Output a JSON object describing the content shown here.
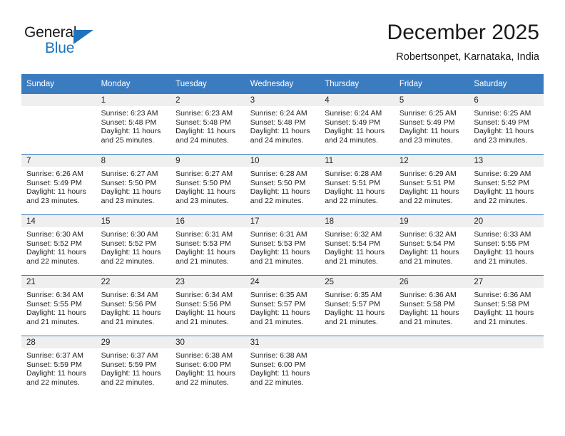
{
  "brand": {
    "name_top": "General",
    "name_bottom": "Blue",
    "triangle_color": "#1e73bd"
  },
  "header": {
    "title": "December 2025",
    "subtitle": "Robertsonpet, Karnataka, India"
  },
  "theme": {
    "header_blue": "#3b7cc0",
    "daynum_band": "#efefef",
    "text": "#222222"
  },
  "calendar": {
    "weekday_headers": [
      "Sunday",
      "Monday",
      "Tuesday",
      "Wednesday",
      "Thursday",
      "Friday",
      "Saturday"
    ],
    "weeks": [
      [
        {
          "day": "",
          "empty": true
        },
        {
          "day": "1",
          "sunrise": "Sunrise: 6:23 AM",
          "sunset": "Sunset: 5:48 PM",
          "daylight1": "Daylight: 11 hours",
          "daylight2": "and 25 minutes."
        },
        {
          "day": "2",
          "sunrise": "Sunrise: 6:23 AM",
          "sunset": "Sunset: 5:48 PM",
          "daylight1": "Daylight: 11 hours",
          "daylight2": "and 24 minutes."
        },
        {
          "day": "3",
          "sunrise": "Sunrise: 6:24 AM",
          "sunset": "Sunset: 5:48 PM",
          "daylight1": "Daylight: 11 hours",
          "daylight2": "and 24 minutes."
        },
        {
          "day": "4",
          "sunrise": "Sunrise: 6:24 AM",
          "sunset": "Sunset: 5:49 PM",
          "daylight1": "Daylight: 11 hours",
          "daylight2": "and 24 minutes."
        },
        {
          "day": "5",
          "sunrise": "Sunrise: 6:25 AM",
          "sunset": "Sunset: 5:49 PM",
          "daylight1": "Daylight: 11 hours",
          "daylight2": "and 23 minutes."
        },
        {
          "day": "6",
          "sunrise": "Sunrise: 6:25 AM",
          "sunset": "Sunset: 5:49 PM",
          "daylight1": "Daylight: 11 hours",
          "daylight2": "and 23 minutes."
        }
      ],
      [
        {
          "day": "7",
          "sunrise": "Sunrise: 6:26 AM",
          "sunset": "Sunset: 5:49 PM",
          "daylight1": "Daylight: 11 hours",
          "daylight2": "and 23 minutes."
        },
        {
          "day": "8",
          "sunrise": "Sunrise: 6:27 AM",
          "sunset": "Sunset: 5:50 PM",
          "daylight1": "Daylight: 11 hours",
          "daylight2": "and 23 minutes."
        },
        {
          "day": "9",
          "sunrise": "Sunrise: 6:27 AM",
          "sunset": "Sunset: 5:50 PM",
          "daylight1": "Daylight: 11 hours",
          "daylight2": "and 23 minutes."
        },
        {
          "day": "10",
          "sunrise": "Sunrise: 6:28 AM",
          "sunset": "Sunset: 5:50 PM",
          "daylight1": "Daylight: 11 hours",
          "daylight2": "and 22 minutes."
        },
        {
          "day": "11",
          "sunrise": "Sunrise: 6:28 AM",
          "sunset": "Sunset: 5:51 PM",
          "daylight1": "Daylight: 11 hours",
          "daylight2": "and 22 minutes."
        },
        {
          "day": "12",
          "sunrise": "Sunrise: 6:29 AM",
          "sunset": "Sunset: 5:51 PM",
          "daylight1": "Daylight: 11 hours",
          "daylight2": "and 22 minutes."
        },
        {
          "day": "13",
          "sunrise": "Sunrise: 6:29 AM",
          "sunset": "Sunset: 5:52 PM",
          "daylight1": "Daylight: 11 hours",
          "daylight2": "and 22 minutes."
        }
      ],
      [
        {
          "day": "14",
          "sunrise": "Sunrise: 6:30 AM",
          "sunset": "Sunset: 5:52 PM",
          "daylight1": "Daylight: 11 hours",
          "daylight2": "and 22 minutes."
        },
        {
          "day": "15",
          "sunrise": "Sunrise: 6:30 AM",
          "sunset": "Sunset: 5:52 PM",
          "daylight1": "Daylight: 11 hours",
          "daylight2": "and 22 minutes."
        },
        {
          "day": "16",
          "sunrise": "Sunrise: 6:31 AM",
          "sunset": "Sunset: 5:53 PM",
          "daylight1": "Daylight: 11 hours",
          "daylight2": "and 21 minutes."
        },
        {
          "day": "17",
          "sunrise": "Sunrise: 6:31 AM",
          "sunset": "Sunset: 5:53 PM",
          "daylight1": "Daylight: 11 hours",
          "daylight2": "and 21 minutes."
        },
        {
          "day": "18",
          "sunrise": "Sunrise: 6:32 AM",
          "sunset": "Sunset: 5:54 PM",
          "daylight1": "Daylight: 11 hours",
          "daylight2": "and 21 minutes."
        },
        {
          "day": "19",
          "sunrise": "Sunrise: 6:32 AM",
          "sunset": "Sunset: 5:54 PM",
          "daylight1": "Daylight: 11 hours",
          "daylight2": "and 21 minutes."
        },
        {
          "day": "20",
          "sunrise": "Sunrise: 6:33 AM",
          "sunset": "Sunset: 5:55 PM",
          "daylight1": "Daylight: 11 hours",
          "daylight2": "and 21 minutes."
        }
      ],
      [
        {
          "day": "21",
          "sunrise": "Sunrise: 6:34 AM",
          "sunset": "Sunset: 5:55 PM",
          "daylight1": "Daylight: 11 hours",
          "daylight2": "and 21 minutes."
        },
        {
          "day": "22",
          "sunrise": "Sunrise: 6:34 AM",
          "sunset": "Sunset: 5:56 PM",
          "daylight1": "Daylight: 11 hours",
          "daylight2": "and 21 minutes."
        },
        {
          "day": "23",
          "sunrise": "Sunrise: 6:34 AM",
          "sunset": "Sunset: 5:56 PM",
          "daylight1": "Daylight: 11 hours",
          "daylight2": "and 21 minutes."
        },
        {
          "day": "24",
          "sunrise": "Sunrise: 6:35 AM",
          "sunset": "Sunset: 5:57 PM",
          "daylight1": "Daylight: 11 hours",
          "daylight2": "and 21 minutes."
        },
        {
          "day": "25",
          "sunrise": "Sunrise: 6:35 AM",
          "sunset": "Sunset: 5:57 PM",
          "daylight1": "Daylight: 11 hours",
          "daylight2": "and 21 minutes."
        },
        {
          "day": "26",
          "sunrise": "Sunrise: 6:36 AM",
          "sunset": "Sunset: 5:58 PM",
          "daylight1": "Daylight: 11 hours",
          "daylight2": "and 21 minutes."
        },
        {
          "day": "27",
          "sunrise": "Sunrise: 6:36 AM",
          "sunset": "Sunset: 5:58 PM",
          "daylight1": "Daylight: 11 hours",
          "daylight2": "and 21 minutes."
        }
      ],
      [
        {
          "day": "28",
          "sunrise": "Sunrise: 6:37 AM",
          "sunset": "Sunset: 5:59 PM",
          "daylight1": "Daylight: 11 hours",
          "daylight2": "and 22 minutes."
        },
        {
          "day": "29",
          "sunrise": "Sunrise: 6:37 AM",
          "sunset": "Sunset: 5:59 PM",
          "daylight1": "Daylight: 11 hours",
          "daylight2": "and 22 minutes."
        },
        {
          "day": "30",
          "sunrise": "Sunrise: 6:38 AM",
          "sunset": "Sunset: 6:00 PM",
          "daylight1": "Daylight: 11 hours",
          "daylight2": "and 22 minutes."
        },
        {
          "day": "31",
          "sunrise": "Sunrise: 6:38 AM",
          "sunset": "Sunset: 6:00 PM",
          "daylight1": "Daylight: 11 hours",
          "daylight2": "and 22 minutes."
        },
        {
          "day": "",
          "empty": true,
          "blank_band": true
        },
        {
          "day": "",
          "empty": true,
          "blank_band": true
        },
        {
          "day": "",
          "empty": true,
          "blank_band": true
        }
      ]
    ]
  }
}
